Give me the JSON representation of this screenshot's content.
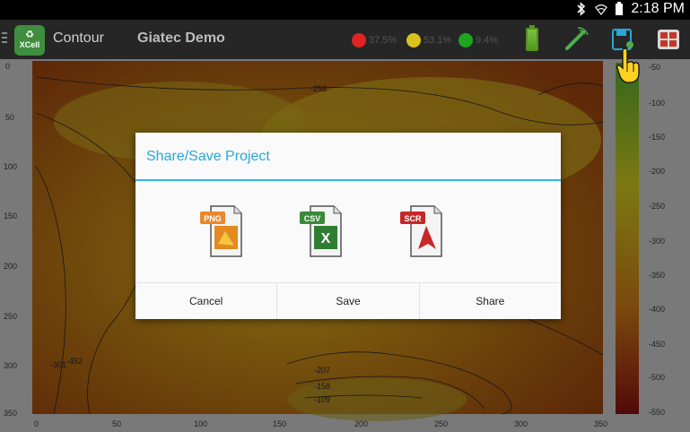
{
  "status_bar": {
    "time": "2:18 PM",
    "icons": [
      "bluetooth-icon",
      "wifi-icon",
      "battery-icon"
    ]
  },
  "action_bar": {
    "logo_text": "XCell",
    "title": "Contour",
    "project": "Giatec Demo",
    "percentages": [
      {
        "color": "#e02424",
        "value": "37.5%"
      },
      {
        "color": "#d9c21a",
        "value": "53.1%"
      },
      {
        "color": "#1fa51f",
        "value": "9.4%"
      }
    ]
  },
  "plot": {
    "y_ticks": [
      "0",
      "50",
      "100",
      "150",
      "200",
      "250",
      "300",
      "350"
    ],
    "x_ticks": [
      "0",
      "50",
      "100",
      "150",
      "200",
      "250",
      "300",
      "350"
    ],
    "colorbar_ticks": [
      "-50",
      "-100",
      "-150",
      "-200",
      "-250",
      "-300",
      "-350",
      "-400",
      "-450",
      "-500",
      "-550"
    ],
    "contour_labels": [
      "-256",
      "-301",
      "-452",
      "-207",
      "-158",
      "-109"
    ]
  },
  "dialog": {
    "title": "Share/Save Project",
    "files": [
      {
        "tag": "PNG",
        "tag_color": "#e9882b"
      },
      {
        "tag": "CSV",
        "tag_color": "#3a8a3a"
      },
      {
        "tag": "SCR",
        "tag_color": "#c62828"
      }
    ],
    "buttons": {
      "cancel": "Cancel",
      "save": "Save",
      "share": "Share"
    }
  }
}
